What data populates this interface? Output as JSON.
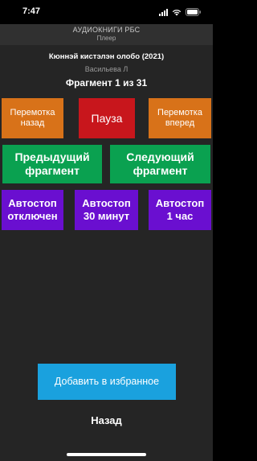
{
  "status_bar": {
    "time": "7:47",
    "icons": [
      "signal-icon",
      "wifi-icon",
      "battery-icon"
    ]
  },
  "header": {
    "title": "АУДИОКНИГИ РБС",
    "subtitle": "Плеер"
  },
  "book": {
    "title": "Кюннэй кистэлэн олобо (2021)",
    "author": "Васильева Л",
    "fragment": "Фрагмент 1 из 31"
  },
  "controls": {
    "rewind": "Перемотка\nназад",
    "pause": "Пауза",
    "forward": "Перемотка\nвперед",
    "previous": "Предыдущий\nфрагмент",
    "next": "Следующий\nфрагмент"
  },
  "autostop": {
    "off": "Автостоп\nотключен",
    "min30": "Автостоп\n30 минут",
    "hour1": "Автостоп\n1 час"
  },
  "actions": {
    "favorite": "Добавить в избранное",
    "back": "Назад"
  },
  "colors": {
    "background": "#252525",
    "orange": "#d87219",
    "red": "#c8161c",
    "green": "#0aa150",
    "purple": "#6a0fd0",
    "blue": "#1aa1de"
  }
}
